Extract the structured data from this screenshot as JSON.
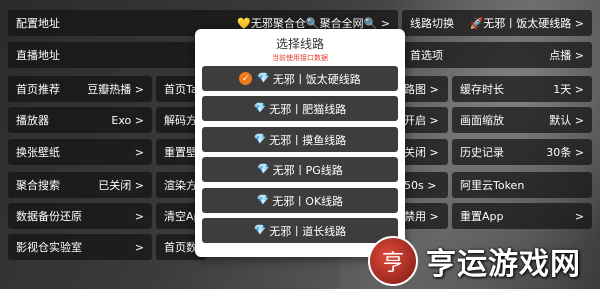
{
  "rows": {
    "config": {
      "label": "配置地址",
      "value": "💛无邪聚合仓🔍聚合全网🔍 >"
    },
    "route_switch": {
      "label": "线路切换",
      "value": "🚀无邪丨饭太硬线路 >"
    },
    "live": {
      "label": "直播地址",
      "value": ">"
    },
    "home_select": {
      "label": "首选项",
      "value": "点播 >"
    },
    "home_recommend": {
      "label": "首页推荐",
      "value": "豆瓣热播 >"
    },
    "home_tab": {
      "label": "首页Ta"
    },
    "route_map": {
      "label": "路图 >"
    },
    "cache": {
      "label": "缓存时长",
      "value": "1天 >"
    },
    "player": {
      "label": "播放器",
      "value": "Exo >"
    },
    "decode": {
      "label": "解码方"
    },
    "open": {
      "label": "开启 >"
    },
    "zoom": {
      "label": "画面缩放",
      "value": "默认 >"
    },
    "wallpaper": {
      "label": "换张壁纸",
      "value": ">"
    },
    "reset_wall": {
      "label": "重置壁"
    },
    "close1": {
      "label": "关闭 >"
    },
    "history": {
      "label": "历史记录",
      "value": "30条 >"
    },
    "agg_search": {
      "label": "聚合搜索",
      "value": "已关闭 >"
    },
    "render": {
      "label": "渲染方"
    },
    "sec50": {
      "label": "50s >"
    },
    "aliyun": {
      "label": "阿里云Token"
    },
    "backup": {
      "label": "数据备份还原",
      "value": ">"
    },
    "clear": {
      "label": "清空Ap"
    },
    "disable": {
      "label": "禁用 >"
    },
    "reset_app": {
      "label": "重置App",
      "value": ">"
    },
    "lab": {
      "label": "影视仓实验室",
      "value": ">"
    },
    "home_data": {
      "label": "首页数"
    }
  },
  "modal": {
    "title": "选择线路",
    "subtitle": "当前使用接口数据",
    "check_mark": "✓",
    "gem": "💎",
    "options": [
      "无邪丨饭太硬线路",
      "无邪丨肥猫线路",
      "无邪丨摸鱼线路",
      "无邪丨PG线路",
      "无邪丨OK线路",
      "无邪丨道长线路"
    ]
  },
  "watermark": {
    "mark": "亨",
    "text": "亨运游戏网"
  }
}
